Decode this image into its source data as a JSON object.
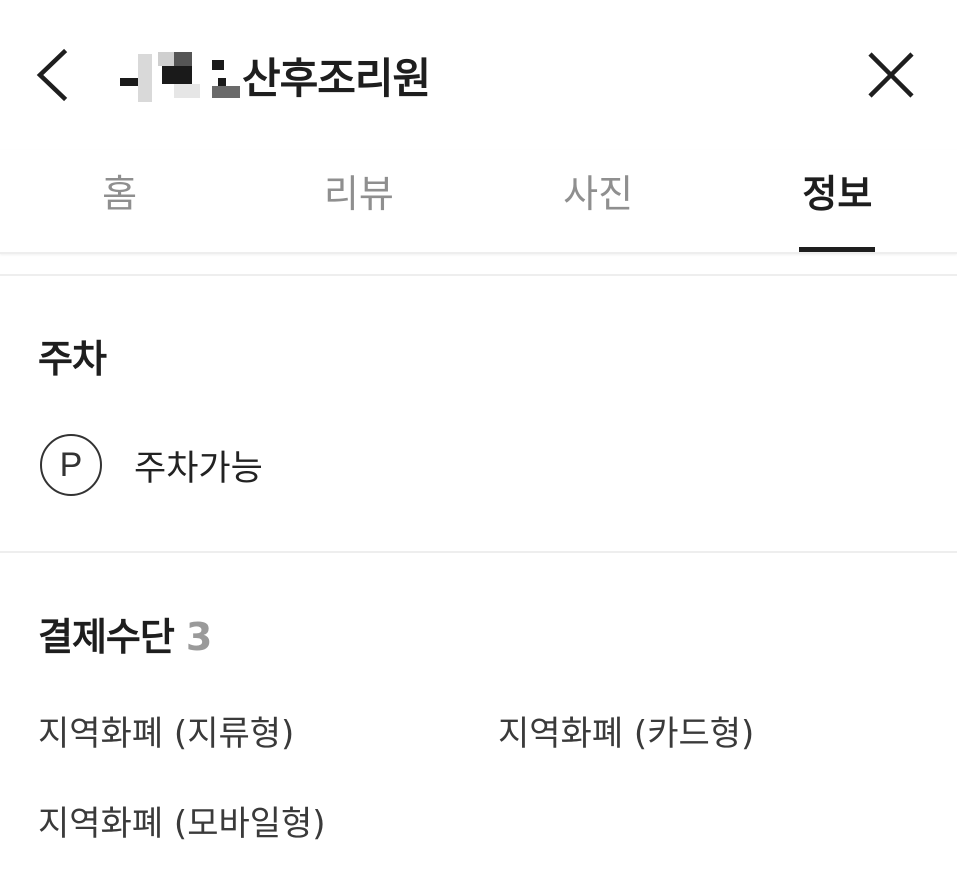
{
  "header": {
    "title": "산후조리원",
    "back_icon": "chevron-left-icon",
    "close_icon": "close-icon"
  },
  "tabs": [
    {
      "label": "홈",
      "active": false
    },
    {
      "label": "리뷰",
      "active": false
    },
    {
      "label": "사진",
      "active": false
    },
    {
      "label": "정보",
      "active": true
    }
  ],
  "parking": {
    "title": "주차",
    "icon": "parking-icon",
    "icon_letter": "P",
    "status": "주차가능"
  },
  "payment": {
    "title": "결제수단",
    "count": "3",
    "methods": [
      "지역화폐 (지류형)",
      "지역화폐 (카드형)",
      "지역화폐 (모바일형)"
    ]
  },
  "colors": {
    "text_primary": "#1e1e1e",
    "text_inactive": "#8f8f8f",
    "count_gray": "#9a9a9a",
    "divider": "#eeeeee",
    "indicator": "#1e1e1e"
  }
}
